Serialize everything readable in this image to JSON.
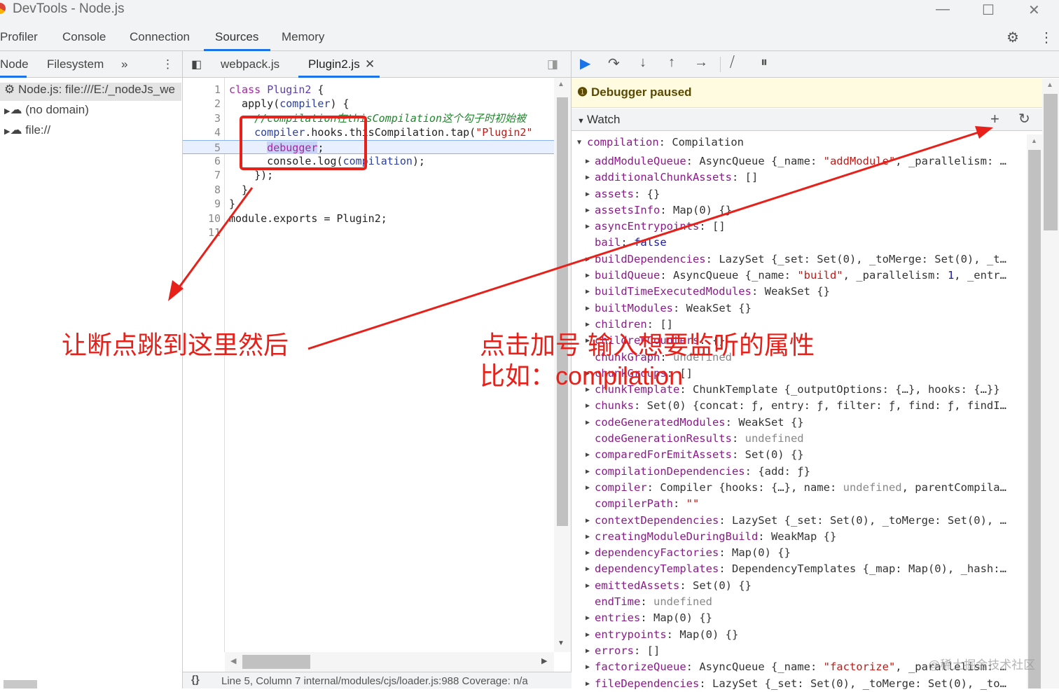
{
  "window": {
    "title": "DevTools - Node.js"
  },
  "main_tabs": [
    "Profiler",
    "Console",
    "Connection",
    "Sources",
    "Memory"
  ],
  "navigator": {
    "tabs": [
      "Node",
      "Filesystem"
    ],
    "items": [
      "Node.js: file:///E:/_nodeJs_we",
      "(no domain)",
      "file://"
    ]
  },
  "editor": {
    "tabs": [
      "webpack.js",
      "Plugin2.js"
    ],
    "lines": [
      [
        {
          "t": "class ",
          "c": "kw"
        },
        {
          "t": "Plugin2",
          "c": "cls"
        },
        {
          "t": " {"
        }
      ],
      [
        {
          "t": "  apply("
        },
        {
          "t": "compiler",
          "c": "var"
        },
        {
          "t": ") {"
        }
      ],
      [
        {
          "t": "    //compilation在thisCompilation这个勾子时初始被",
          "c": "cm"
        }
      ],
      [
        {
          "t": "    "
        },
        {
          "t": "compiler",
          "c": "var"
        },
        {
          "t": ".hooks.thisCompilation.tap("
        },
        {
          "t": "\"Plugin2\"",
          "c": "str"
        }
      ],
      [
        {
          "t": "      "
        },
        {
          "t": "debugger",
          "c": "hl"
        },
        {
          "t": ";"
        }
      ],
      [
        {
          "t": "      console.log("
        },
        {
          "t": "compilation",
          "c": "var"
        },
        {
          "t": ");"
        }
      ],
      [
        {
          "t": "    });"
        }
      ],
      [
        {
          "t": "  }"
        }
      ],
      [
        {
          "t": "}"
        }
      ],
      [
        {
          "t": "module.exports = Plugin2;"
        }
      ],
      [
        {
          "t": ""
        }
      ]
    ],
    "status": "Line 5, Column 7  internal/modules/cjs/loader.js:988  Coverage: n/a"
  },
  "debugger": {
    "paused": "Debugger paused",
    "watch_label": "Watch",
    "root": {
      "key": "compilation",
      "value": "Compilation"
    },
    "rows": [
      {
        "k": "addModuleQueue",
        "e": true,
        "v": [
          {
            "t": "AsyncQueue {_name: "
          },
          {
            "t": "\"addModule\"",
            "c": "str"
          },
          {
            "t": ", _parallelism: …"
          }
        ]
      },
      {
        "k": "additionalChunkAssets",
        "e": true,
        "v": [
          {
            "t": "[]"
          }
        ]
      },
      {
        "k": "assets",
        "e": true,
        "v": [
          {
            "t": "{}"
          }
        ]
      },
      {
        "k": "assetsInfo",
        "e": true,
        "v": [
          {
            "t": "Map(0) {}"
          }
        ]
      },
      {
        "k": "asyncEntrypoints",
        "e": true,
        "v": [
          {
            "t": "[]"
          }
        ]
      },
      {
        "k": "bail",
        "e": false,
        "v": [
          {
            "t": "false",
            "c": "bool"
          }
        ]
      },
      {
        "k": "buildDependencies",
        "e": true,
        "v": [
          {
            "t": "LazySet {_set: Set(0), _toMerge: Set(0), _t…"
          }
        ]
      },
      {
        "k": "buildQueue",
        "e": true,
        "v": [
          {
            "t": "AsyncQueue {_name: "
          },
          {
            "t": "\"build\"",
            "c": "str"
          },
          {
            "t": ", _parallelism: "
          },
          {
            "t": "1",
            "c": "num"
          },
          {
            "t": ", _entr…"
          }
        ]
      },
      {
        "k": "buildTimeExecutedModules",
        "e": true,
        "v": [
          {
            "t": "WeakSet {}"
          }
        ]
      },
      {
        "k": "builtModules",
        "e": true,
        "v": [
          {
            "t": "WeakSet {}"
          }
        ]
      },
      {
        "k": "children",
        "e": true,
        "v": [
          {
            "t": "[]"
          }
        ]
      },
      {
        "k": "childrenCounters",
        "e": true,
        "v": [
          {
            "t": "{}"
          }
        ]
      },
      {
        "k": "chunkGraph",
        "e": false,
        "v": [
          {
            "t": "undefined",
            "c": "undef"
          }
        ]
      },
      {
        "k": "chunkGroups",
        "e": true,
        "v": [
          {
            "t": "[]"
          }
        ]
      },
      {
        "k": "chunkTemplate",
        "e": true,
        "v": [
          {
            "t": "ChunkTemplate {_outputOptions: {…}, hooks: {…}}"
          }
        ]
      },
      {
        "k": "chunks",
        "e": true,
        "v": [
          {
            "t": "Set(0) {concat: ƒ, entry: ƒ, filter: ƒ, find: ƒ, findI…"
          }
        ]
      },
      {
        "k": "codeGeneratedModules",
        "e": true,
        "v": [
          {
            "t": "WeakSet {}"
          }
        ]
      },
      {
        "k": "codeGenerationResults",
        "e": false,
        "v": [
          {
            "t": "undefined",
            "c": "undef"
          }
        ]
      },
      {
        "k": "comparedForEmitAssets",
        "e": true,
        "v": [
          {
            "t": "Set(0) {}"
          }
        ]
      },
      {
        "k": "compilationDependencies",
        "e": true,
        "v": [
          {
            "t": "{add: ƒ}"
          }
        ]
      },
      {
        "k": "compiler",
        "e": true,
        "v": [
          {
            "t": "Compiler {hooks: {…}, name: "
          },
          {
            "t": "undefined",
            "c": "undef"
          },
          {
            "t": ", parentCompila…"
          }
        ]
      },
      {
        "k": "compilerPath",
        "e": false,
        "v": [
          {
            "t": "\"\"",
            "c": "str"
          }
        ]
      },
      {
        "k": "contextDependencies",
        "e": true,
        "v": [
          {
            "t": "LazySet {_set: Set(0), _toMerge: Set(0), …"
          }
        ]
      },
      {
        "k": "creatingModuleDuringBuild",
        "e": true,
        "v": [
          {
            "t": "WeakMap {}"
          }
        ]
      },
      {
        "k": "dependencyFactories",
        "e": true,
        "v": [
          {
            "t": "Map(0) {}"
          }
        ]
      },
      {
        "k": "dependencyTemplates",
        "e": true,
        "v": [
          {
            "t": "DependencyTemplates {_map: Map(0), _hash:…"
          }
        ]
      },
      {
        "k": "emittedAssets",
        "e": true,
        "v": [
          {
            "t": "Set(0) {}"
          }
        ]
      },
      {
        "k": "endTime",
        "e": false,
        "v": [
          {
            "t": "undefined",
            "c": "undef"
          }
        ]
      },
      {
        "k": "entries",
        "e": true,
        "v": [
          {
            "t": "Map(0) {}"
          }
        ]
      },
      {
        "k": "entrypoints",
        "e": true,
        "v": [
          {
            "t": "Map(0) {}"
          }
        ]
      },
      {
        "k": "errors",
        "e": true,
        "v": [
          {
            "t": "[]"
          }
        ]
      },
      {
        "k": "factorizeQueue",
        "e": true,
        "v": [
          {
            "t": "AsyncQueue {_name: "
          },
          {
            "t": "\"factorize\"",
            "c": "str"
          },
          {
            "t": ", _parallelism: …"
          }
        ]
      },
      {
        "k": "fileDependencies",
        "e": true,
        "v": [
          {
            "t": "LazySet {_set: Set(0), _toMerge: Set(0), _to…"
          }
        ]
      }
    ]
  },
  "annotations": {
    "left": "让断点跳到这里然后",
    "right1": "点击加号 输入想要监听的属性",
    "right2": "比如：compilation"
  },
  "watermark": "@稀土掘金技术社区",
  "colors": {
    "accent": "#1a73e8",
    "annotation": "#e8201a",
    "paused_bg": "#fffbe0"
  }
}
